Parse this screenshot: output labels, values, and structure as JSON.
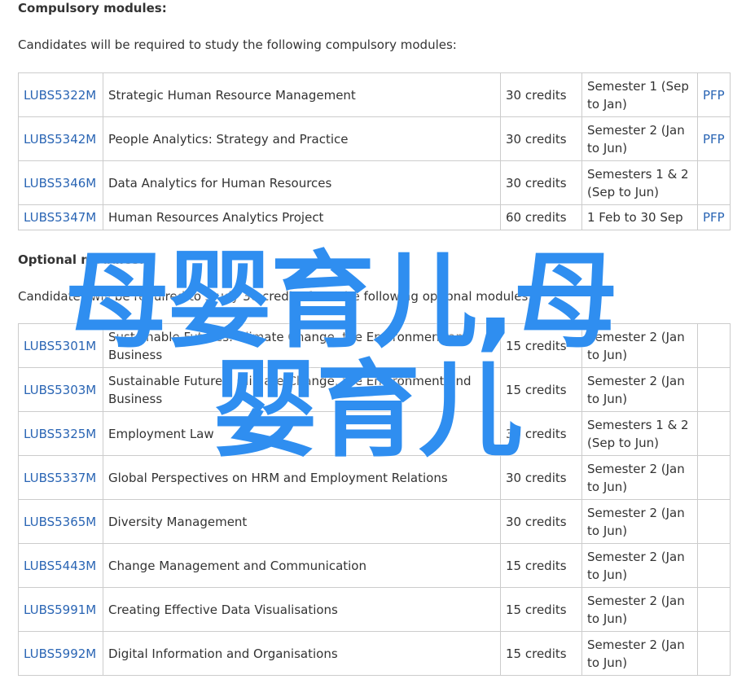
{
  "compulsory": {
    "heading": "Compulsory modules:",
    "intro": "Candidates will be required to study the following compulsory modules:",
    "rows": [
      {
        "code": "LUBS5322M",
        "title": "Strategic Human Resource Management",
        "credits": "30 credits",
        "semester": "Semester 1 (Sep to Jan)",
        "pfp": "PFP"
      },
      {
        "code": "LUBS5342M",
        "title": "People Analytics: Strategy and Practice",
        "credits": "30 credits",
        "semester": "Semester 2 (Jan to Jun)",
        "pfp": "PFP"
      },
      {
        "code": "LUBS5346M",
        "title": "Data Analytics for Human Resources",
        "credits": "30 credits",
        "semester": "Semesters 1 & 2 (Sep to Jun)",
        "pfp": ""
      },
      {
        "code": "LUBS5347M",
        "title": "Human Resources Analytics Project",
        "credits": "60 credits",
        "semester": "1 Feb to 30 Sep",
        "pfp": "PFP"
      }
    ]
  },
  "optional": {
    "heading": "Optional modules:",
    "intro": "Candidates will be required to study 30 credits from the following optional modules:",
    "rows": [
      {
        "code": "LUBS5301M",
        "title": "Sustainable Futures: Climate Change, the Environment and Business",
        "credits": "15 credits",
        "semester": "Semester 2 (Jan to Jun)",
        "pfp": ""
      },
      {
        "code": "LUBS5303M",
        "title": "Sustainable Futures: Climate Change, the Environment and Business",
        "credits": "15 credits",
        "semester": "Semester 2 (Jan to Jun)",
        "pfp": ""
      },
      {
        "code": "LUBS5325M",
        "title": "Employment Law",
        "credits": "30 credits",
        "semester": "Semesters 1 & 2 (Sep to Jun)",
        "pfp": ""
      },
      {
        "code": "LUBS5337M",
        "title": "Global Perspectives on HRM and Employment Relations",
        "credits": "30 credits",
        "semester": "Semester 2 (Jan to Jun)",
        "pfp": ""
      },
      {
        "code": "LUBS5365M",
        "title": "Diversity Management",
        "credits": "30 credits",
        "semester": "Semester 2 (Jan to Jun)",
        "pfp": ""
      },
      {
        "code": "LUBS5443M",
        "title": "Change Management and Communication",
        "credits": "15 credits",
        "semester": "Semester 2 (Jan to Jun)",
        "pfp": ""
      },
      {
        "code": "LUBS5991M",
        "title": "Creating Effective Data Visualisations",
        "credits": "15 credits",
        "semester": "Semester 2 (Jan to Jun)",
        "pfp": ""
      },
      {
        "code": "LUBS5992M",
        "title": "Digital Information and Organisations",
        "credits": "15 credits",
        "semester": "Semester 2 (Jan to Jun)",
        "pfp": ""
      }
    ]
  },
  "watermark": {
    "line1": "母婴育儿,母",
    "line2": "婴育儿"
  }
}
